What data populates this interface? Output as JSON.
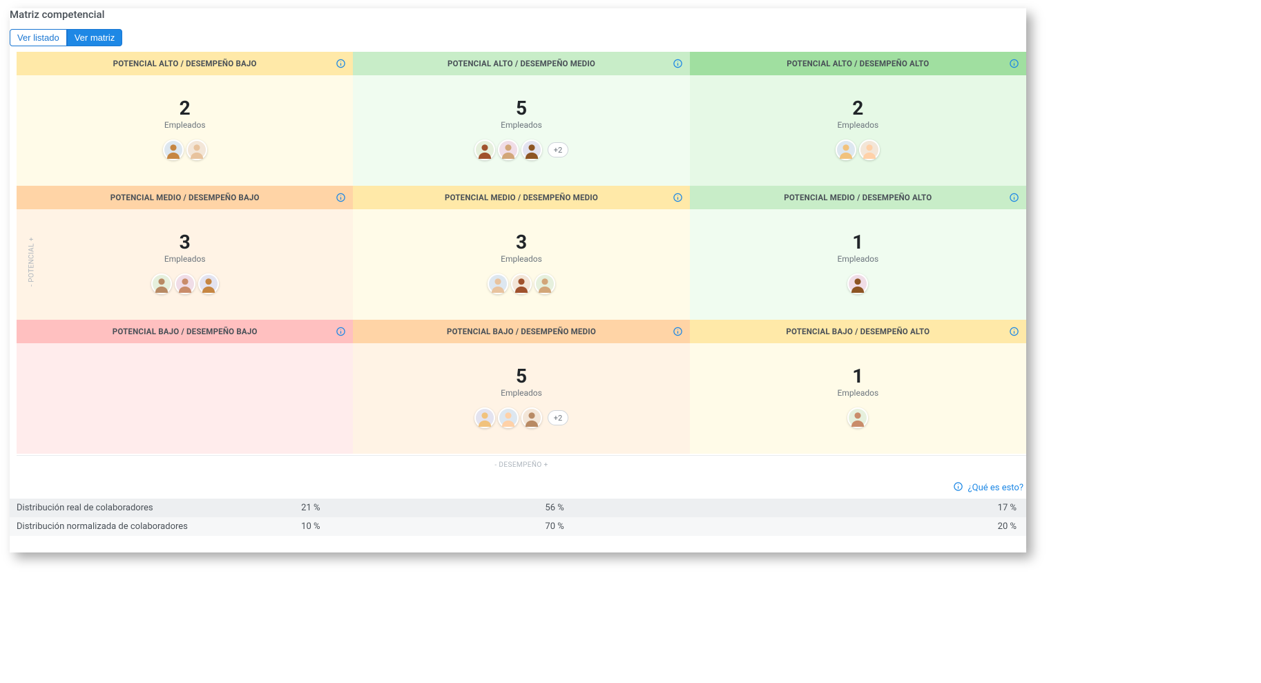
{
  "title": "Matriz competencial",
  "view_toggle": {
    "list": "Ver listado",
    "matrix": "Ver matriz"
  },
  "axes": {
    "y": "- POTENCIAL +",
    "x": "- DESEMPEÑO +"
  },
  "employees_label": "Empleados",
  "help": "¿Qué es esto?",
  "cells": [
    {
      "header": "POTENCIAL ALTO / DESEMPEÑO BAJO",
      "header_cls": "h-yellow",
      "body_cls": "b-yellow",
      "count": "2",
      "avatars": 2,
      "more": ""
    },
    {
      "header": "POTENCIAL ALTO / DESEMPEÑO MEDIO",
      "header_cls": "h-lgreen",
      "body_cls": "b-lgreen",
      "count": "5",
      "avatars": 3,
      "more": "+2"
    },
    {
      "header": "POTENCIAL ALTO / DESEMPEÑO ALTO",
      "header_cls": "h-green",
      "body_cls": "b-green",
      "count": "2",
      "avatars": 2,
      "more": ""
    },
    {
      "header": "POTENCIAL MEDIO / DESEMPEÑO BAJO",
      "header_cls": "h-orange",
      "body_cls": "b-orange",
      "count": "3",
      "avatars": 3,
      "more": ""
    },
    {
      "header": "POTENCIAL MEDIO / DESEMPEÑO MEDIO",
      "header_cls": "h-yellow",
      "body_cls": "b-yellow",
      "count": "3",
      "avatars": 3,
      "more": ""
    },
    {
      "header": "POTENCIAL MEDIO / DESEMPEÑO ALTO",
      "header_cls": "h-lgreen",
      "body_cls": "b-lgreen",
      "count": "1",
      "avatars": 1,
      "more": ""
    },
    {
      "header": "POTENCIAL BAJO / DESEMPEÑO BAJO",
      "header_cls": "h-red",
      "body_cls": "b-red",
      "count": "",
      "avatars": 0,
      "more": ""
    },
    {
      "header": "POTENCIAL BAJO / DESEMPEÑO MEDIO",
      "header_cls": "h-orange",
      "body_cls": "b-orange",
      "count": "5",
      "avatars": 3,
      "more": "+2"
    },
    {
      "header": "POTENCIAL BAJO / DESEMPEÑO ALTO",
      "header_cls": "h-yellow",
      "body_cls": "b-yellow",
      "count": "1",
      "avatars": 1,
      "more": ""
    }
  ],
  "distribution": {
    "rows": [
      {
        "label": "Distribución real de colaboradores",
        "v1": "21 %",
        "v2": "56 %",
        "v3": "17 %",
        "cls": ""
      },
      {
        "label": "Distribución normalizada de colaboradores",
        "v1": "10 %",
        "v2": "70 %",
        "v3": "20 %",
        "cls": "norm"
      }
    ]
  },
  "avatar_colors": [
    "#c68642",
    "#e8c39e",
    "#a0522d",
    "#d2a679",
    "#8d5524",
    "#f1c27d",
    "#ffd1a8",
    "#b88a64",
    "#c98c6a"
  ]
}
